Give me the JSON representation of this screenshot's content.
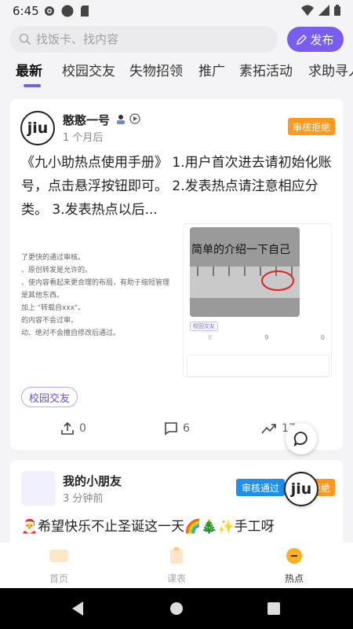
{
  "status": {
    "time": "6:45",
    "left_icons": [
      "gear-icon",
      "circle-icon",
      "sdcard-icon"
    ],
    "right_icons": [
      "wifi-icon",
      "signal-icon",
      "battery-icon"
    ]
  },
  "search": {
    "placeholder": "找饭卡、找内容",
    "publish_label": "发布"
  },
  "tabs": [
    "最新",
    "校园交友",
    "失物招领",
    "推广",
    "素拓活动",
    "求助寻人"
  ],
  "active_tab_index": 0,
  "colors": {
    "accent": "#7b5cf0",
    "reject": "#ff9a1f",
    "pass": "#1e90e8"
  },
  "posts": [
    {
      "author": "憨憨一号",
      "avatar_text": "jiu",
      "time": "1 个月后",
      "status": "审核拒绝",
      "text": "《九小助热点使用手册》 1.用户首次进去请初始化账号，点击悬浮按钮即可。 2.发表热点请注意相应分类。 3.发表热点以后...",
      "preview": {
        "doc_lines": [
          "了更快的通过审核。",
          "、原创转发是允许的。",
          "、使内容看起来更合理的布局，有助于缩短管理",
          "是其他东西。",
          "加上 \"转载自xxx\"。",
          "的内容不会过审。",
          "动、绝对不会擅自修改后通过。"
        ],
        "shot_text": "简单的介绍一下自己",
        "shot_tag": "校园交友",
        "shot_comments": "9",
        "shot_trend": "0"
      },
      "tag": "校园交友",
      "shares": "0",
      "comments": "6",
      "trend": "17"
    },
    {
      "author": "我的小朋友",
      "time": "3 分钟前",
      "status_pass": "审核通过",
      "status_reject": "审核拒绝",
      "text": "🎅希望快乐不止圣诞这一天🌈🎄✨手工呀"
    }
  ],
  "floating": {
    "jiu_text": "jiu"
  },
  "bottom_nav": [
    {
      "label": "首页",
      "active": false
    },
    {
      "label": "课表",
      "active": false
    },
    {
      "label": "热点",
      "active": true
    }
  ]
}
